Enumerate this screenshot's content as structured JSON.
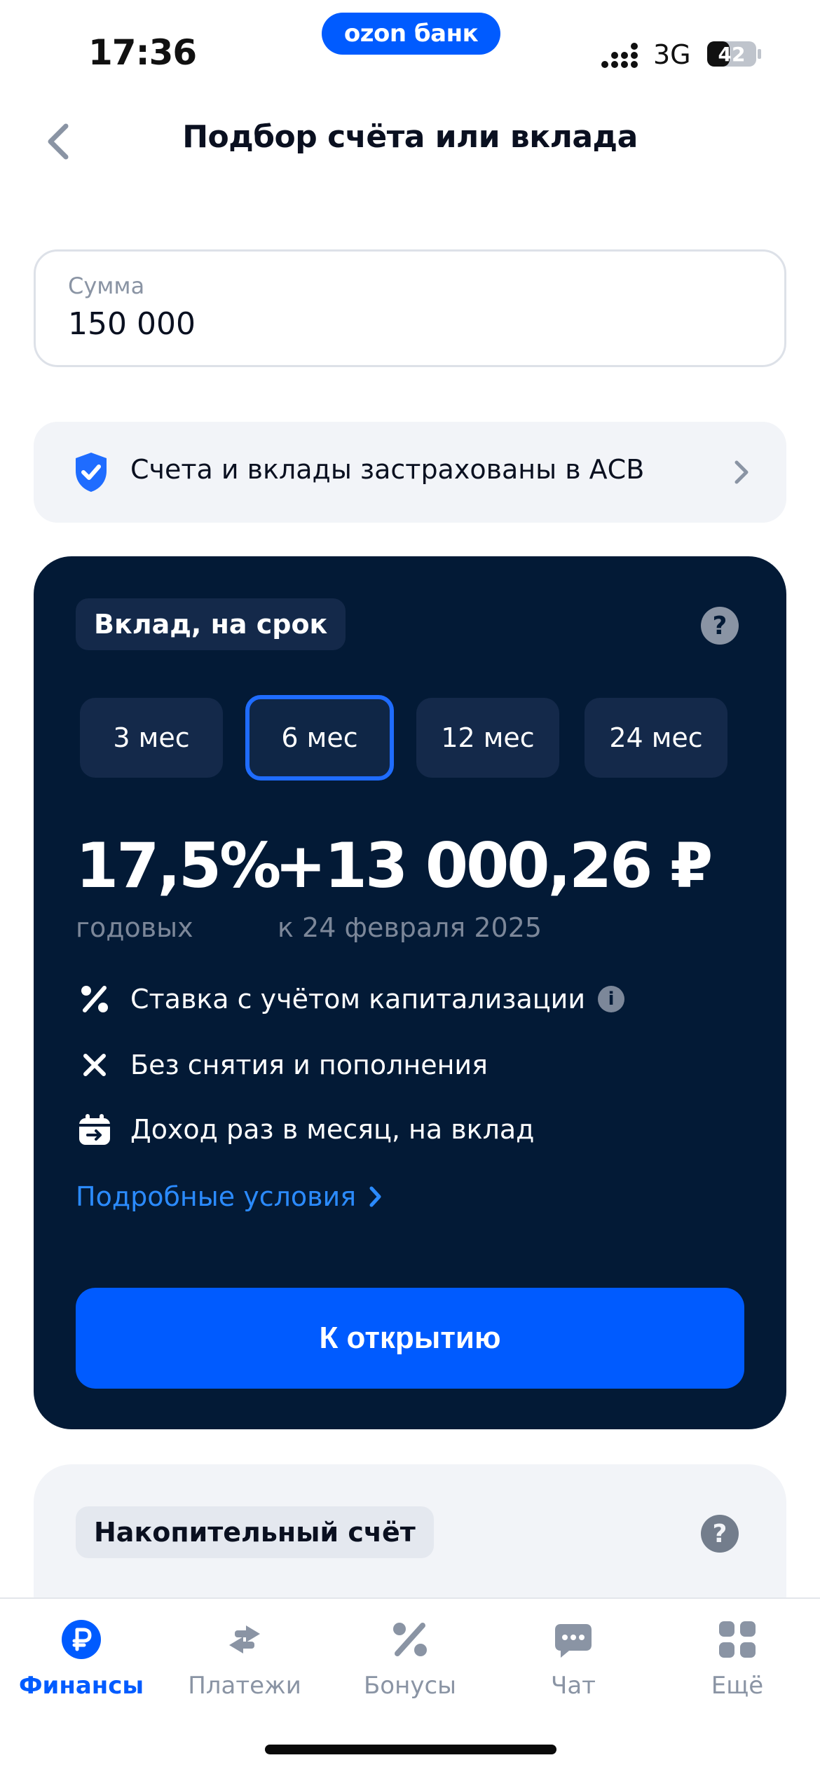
{
  "status_bar": {
    "time": "17:36",
    "brand": "ozon банк",
    "network": "3G",
    "battery": "42"
  },
  "nav": {
    "title": "Подбор счёта или вклада"
  },
  "amount_field": {
    "label": "Сумма",
    "value": "150 000"
  },
  "insurance": {
    "text": "Счета и вклады застрахованы в АСВ"
  },
  "deposit_card": {
    "tag": "Вклад, на срок",
    "help": "?",
    "terms": [
      "3 мес",
      "6 мес",
      "12 мес",
      "24 мес"
    ],
    "selected_term": "6 мес",
    "rate": "17,5%",
    "rate_sub": "годовых",
    "income": "+13 000,26 ₽",
    "income_sub": "к 24 февраля 2025",
    "features": [
      "Ставка с учётом капитализации",
      "Без снятия и пополнения",
      "Доход раз в месяц, на вклад"
    ],
    "details_link": "Подробные условия",
    "open_button": "К открытию"
  },
  "savings_card": {
    "tag": "Накопительный счёт",
    "help": "?"
  },
  "tab_bar": {
    "items": [
      "Финансы",
      "Платежи",
      "Бонусы",
      "Чат",
      "Ещё"
    ],
    "active": "Финансы"
  },
  "colors": {
    "accent": "#005bff",
    "card_bg": "#031a36",
    "link": "#2b8bff"
  }
}
